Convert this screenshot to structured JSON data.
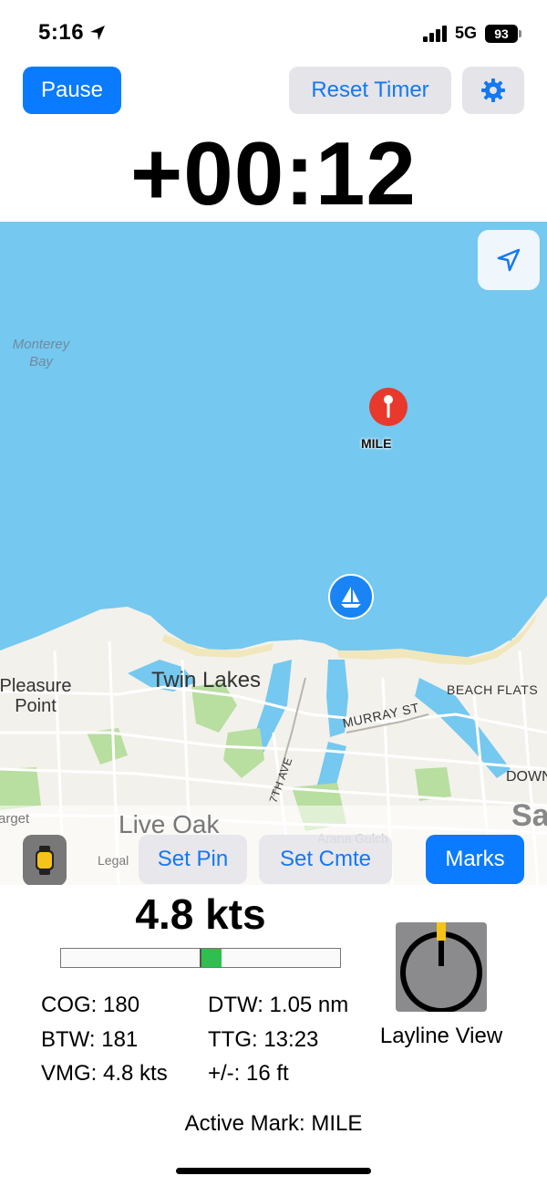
{
  "status_bar": {
    "time": "5:16",
    "network": "5G",
    "battery": "93"
  },
  "toolbar": {
    "pause_label": "Pause",
    "reset_label": "Reset Timer",
    "settings_icon": "gear-icon"
  },
  "timer": {
    "value": "+00:12"
  },
  "map": {
    "labels": {
      "bay": "Monterey\nBay",
      "pleasure_point": "Pleasure\nPoint",
      "twin_lakes": "Twin Lakes",
      "live_oak": "Live Oak",
      "beach_flats": "BEACH FLATS",
      "murray_st": "MURRAY ST",
      "seventh_ave": "7TH AVE",
      "downtown": "DOWN",
      "target": "arget",
      "arana_gulch": "Arana Gulch",
      "santa_cruz": "Sa"
    },
    "pin_label": "MILE",
    "legal": "Legal",
    "colors": {
      "water": "#75c8ef",
      "land": "#f3f1ec",
      "park": "#b8dea0",
      "beach": "#f1e7bd",
      "pin": "#e8392c",
      "boat": "#1a84f5"
    }
  },
  "map_buttons": {
    "set_pin": "Set Pin",
    "set_cmte": "Set Cmte",
    "marks": "Marks"
  },
  "speed": {
    "value": "4.8 kts",
    "bar_fill_start": 0.5,
    "bar_fill_end": 0.575
  },
  "stats": {
    "cog": "COG: 180",
    "btw": "BTW: 181",
    "vmg": "VMG: 4.8 kts",
    "dtw": "DTW: 1.05 nm",
    "ttg": "TTG: 13:23",
    "plus_minus": "+/-: 16 ft"
  },
  "layline": {
    "label": "Layline View"
  },
  "active_mark": "Active Mark: MILE",
  "accent_color": "#0a7aff",
  "speed_bar_color": "#2fbf4e",
  "layline_indicator_color": "#f6c31a"
}
